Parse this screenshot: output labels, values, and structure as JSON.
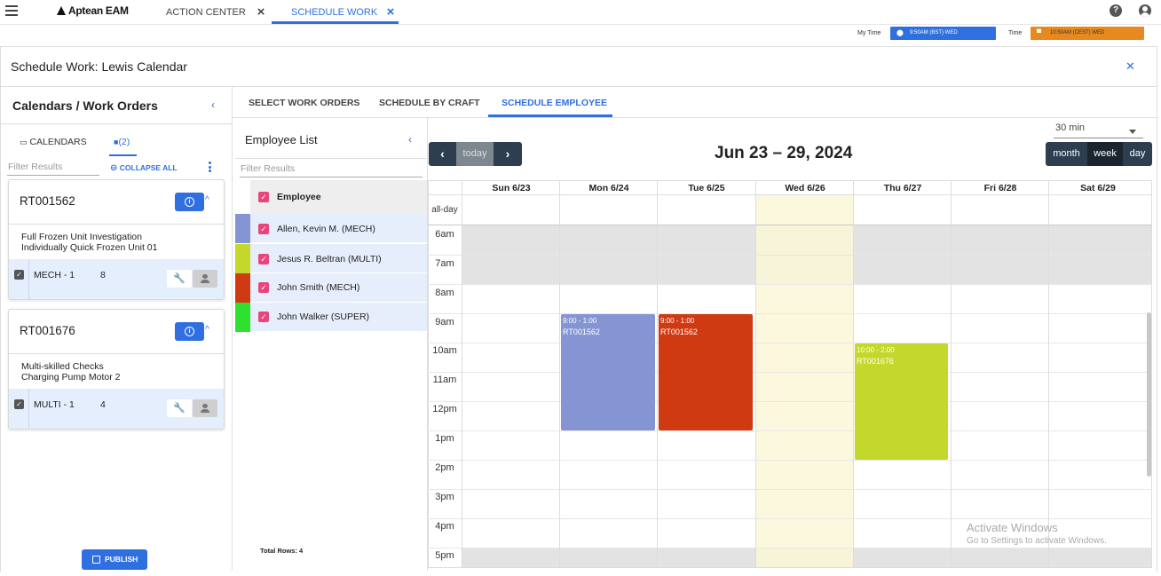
{
  "topbar": {
    "app_name": "Aptean EAM",
    "tabs": [
      {
        "label": "ACTION CENTER",
        "active": false
      },
      {
        "label": "SCHEDULE WORK",
        "active": true
      }
    ]
  },
  "timebar": {
    "my_time_label": "My Time",
    "my_time_value": "9:50AM (BST) WED",
    "time_label": "Time",
    "time_value": "10:50AM (CEST) WED",
    "colors": {
      "my_time": "#2f6fe0",
      "time": "#e8891f"
    }
  },
  "header": {
    "title": "Schedule Work: Lewis Calendar"
  },
  "left_panel": {
    "title": "Calendars / Work Orders",
    "tabs": [
      {
        "label": "CALENDARS"
      },
      {
        "label": "(2)"
      }
    ],
    "filter_placeholder": "Filter Results",
    "collapse_all": "COLLAPSE ALL",
    "work_orders": [
      {
        "id": "RT001562",
        "desc1": "Full Frozen Unit Investigation",
        "desc2": "Individually Quick Frozen Unit 01",
        "craft": "MECH - 1",
        "hours": "8"
      },
      {
        "id": "RT001676",
        "desc1": "Multi-skilled Checks",
        "desc2": "Charging Pump Motor 2",
        "craft": "MULTI - 1",
        "hours": "4"
      }
    ],
    "publish": "PUBLISH"
  },
  "right_tabs": [
    {
      "label": "SELECT WORK ORDERS"
    },
    {
      "label": "SCHEDULE BY CRAFT"
    },
    {
      "label": "SCHEDULE EMPLOYEE"
    }
  ],
  "employee_list": {
    "title": "Employee List",
    "filter_placeholder": "Filter Results",
    "header": "Employee",
    "employees": [
      {
        "name": "Allen, Kevin M. (MECH)",
        "color": "#8595d4"
      },
      {
        "name": "Jesus R. Beltran (MULTI)",
        "color": "#c3d82a"
      },
      {
        "name": "John Smith (MECH)",
        "color": "#cf3a12"
      },
      {
        "name": "John Walker (SUPER)",
        "color": "#2ee12e"
      }
    ],
    "total_rows": "Total Rows: 4"
  },
  "calendar": {
    "today": "today",
    "title": "Jun 23 – 29, 2024",
    "views": [
      "month",
      "week",
      "day"
    ],
    "active_view": "week",
    "slot": "30 min",
    "days": [
      "Sun 6/23",
      "Mon 6/24",
      "Tue 6/25",
      "Wed 6/26",
      "Thu 6/27",
      "Fri 6/28",
      "Sat 6/29"
    ],
    "all_day": "all-day",
    "hours": [
      "6am",
      "7am",
      "8am",
      "9am",
      "10am",
      "11am",
      "12pm",
      "1pm",
      "2pm",
      "3pm",
      "4pm",
      "5pm"
    ],
    "events": [
      {
        "time": "9:00 - 1:00",
        "wo": "RT001562",
        "color": "#8595d4"
      },
      {
        "time": "9:00 - 1:00",
        "wo": "RT001562",
        "color": "#cf3a12"
      },
      {
        "time": "10:00 - 2:00",
        "wo": "RT001676",
        "color": "#c3d82a"
      }
    ]
  },
  "watermark": {
    "line1": "Activate Windows",
    "line2": "Go to Settings to activate Windows."
  }
}
